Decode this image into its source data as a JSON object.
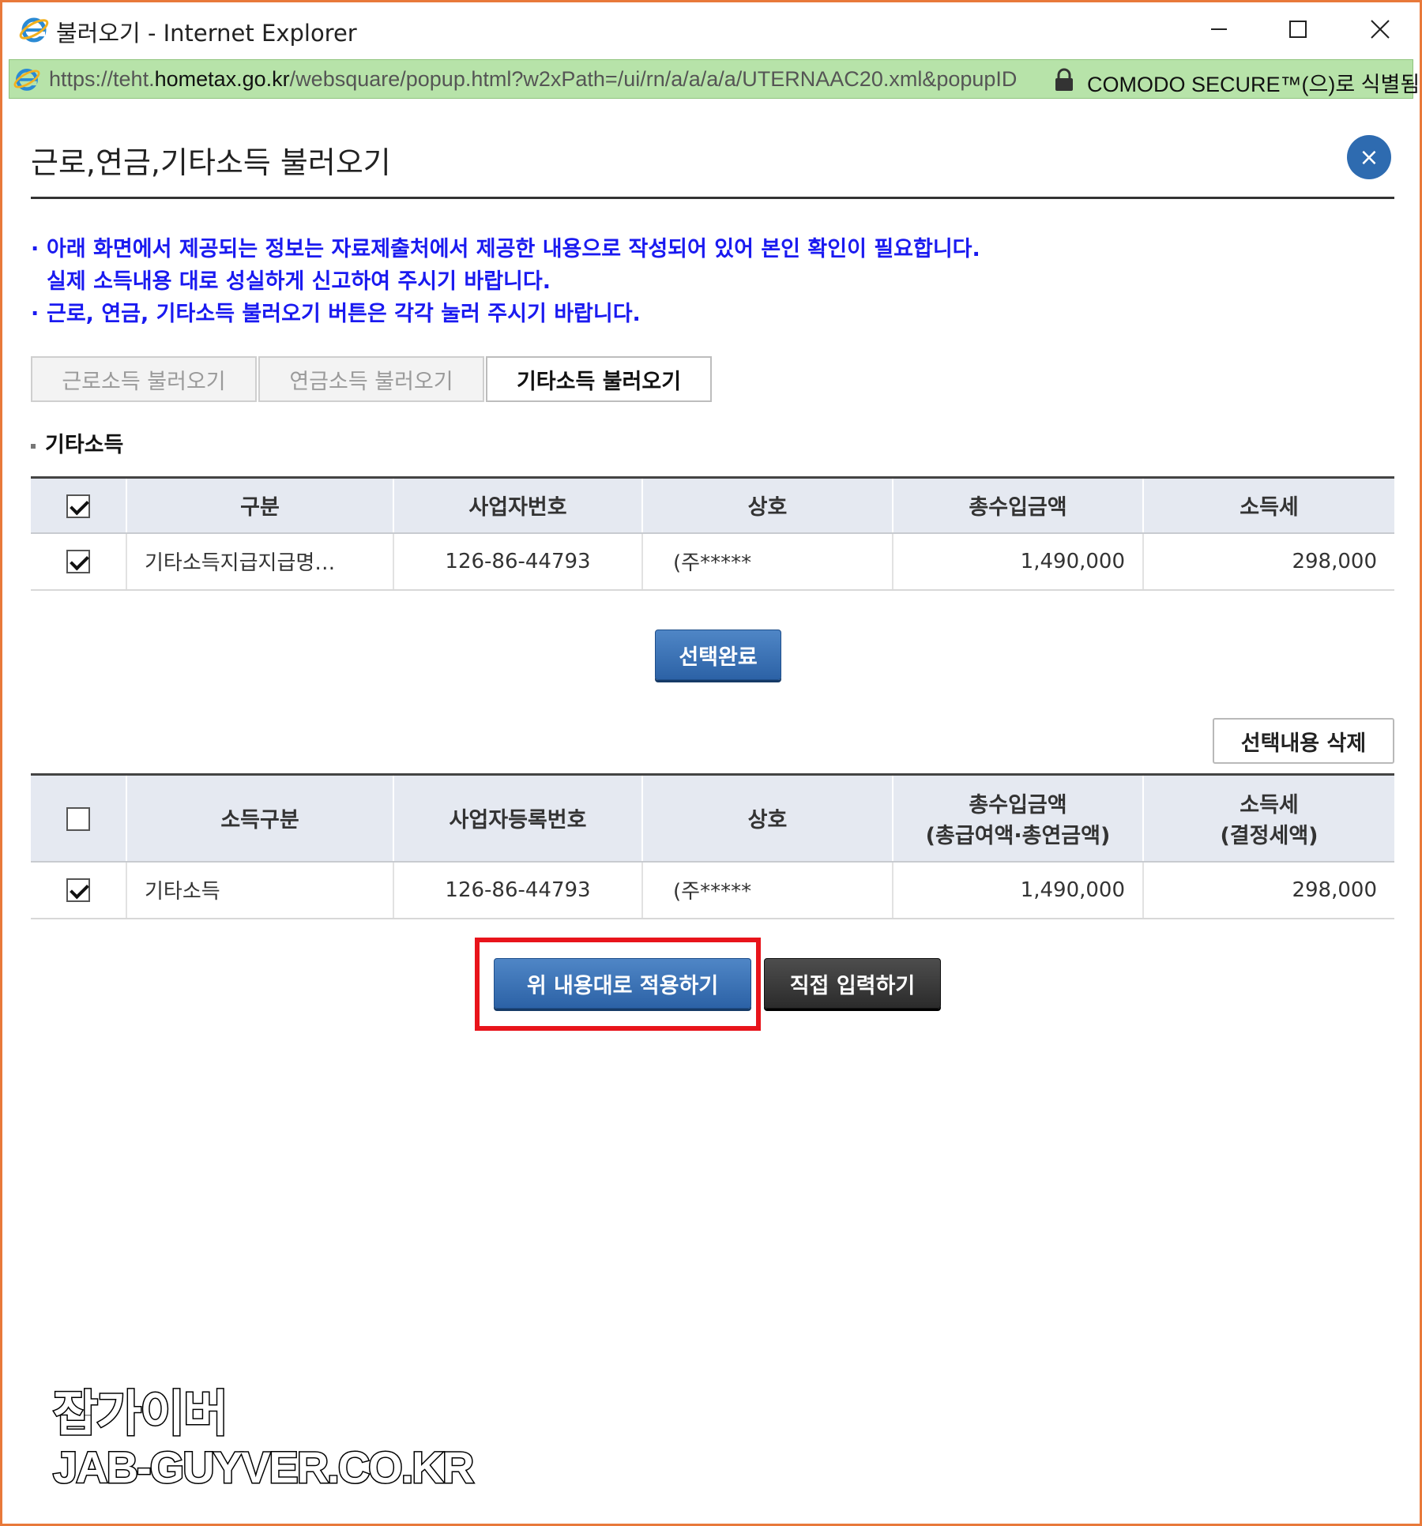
{
  "window": {
    "title": "불러오기 - Internet Explorer",
    "address_prefix": "https://teht.",
    "address_host": "hometax.go.kr",
    "address_path": "/websquare/popup.html?w2xPath=/ui/rn/a/a/a/a/UTERNAAC20.xml&popupID",
    "certificate": "COMODO SECURE™(으)로 식별됨",
    "accent_color": "#e8793a",
    "address_bg": "#b7e3a9"
  },
  "popup": {
    "title": "근로,연금,기타소득 불러오기",
    "close_label": "×",
    "notice_lines": [
      "아래 화면에서 제공되는 정보는 자료제출처에서 제공한 내용으로 작성되어 있어 본인 확인이 필요합니다.",
      "실제 소득내용 대로 성실하게 신고하여 주시기 바랍니다.",
      "근로, 연금, 기타소득 불러오기 버튼은 각각 눌러 주시기 바랍니다."
    ],
    "tabs": [
      "근로소득 불러오기",
      "연금소득 불러오기",
      "기타소득 불러오기"
    ],
    "active_tab": 2,
    "section_label": "기타소득"
  },
  "table1": {
    "headers": [
      "구분",
      "사업자번호",
      "상호",
      "총수입금액",
      "소득세"
    ],
    "rows": [
      {
        "checked": true,
        "cells": [
          "기타소득지급지급명…",
          "126-86-44793",
          "(주*****",
          "1,490,000",
          "298,000"
        ]
      }
    ]
  },
  "select_complete_button": "선택완료",
  "delete_selected_button": "선택내용 삭제",
  "table2": {
    "headers": [
      "소득구분",
      "사업자등록번호",
      "상호",
      "총수입금액",
      "소득세"
    ],
    "header_sub": [
      "",
      "",
      "",
      "(총급여액·총연금액)",
      "(결정세액)"
    ],
    "rows": [
      {
        "checked": true,
        "cells": [
          "기타소득",
          "126-86-44793",
          "(주*****",
          "1,490,000",
          "298,000"
        ]
      }
    ]
  },
  "apply_button": "위 내용대로 적용하기",
  "manual_input_button": "직접 입력하기",
  "watermark": {
    "line1": "잡가이버",
    "line2": "JAB-GUYVER.CO.KR"
  }
}
